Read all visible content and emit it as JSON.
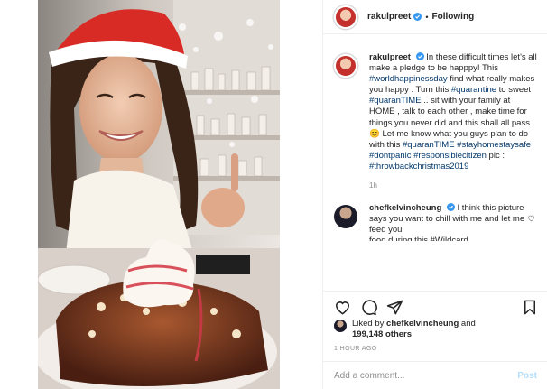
{
  "post": {
    "username": "rakulpreet",
    "follow_status": "Following",
    "separator": "•"
  },
  "caption": {
    "username": "rakulpreet",
    "segments": [
      {
        "text": "In these difficult times let's all make a pledge to be happpy! This ",
        "type": "text"
      },
      {
        "text": "#worldhappinessday",
        "type": "tag"
      },
      {
        "text": " find what really makes you happy . Turn this ",
        "type": "text"
      },
      {
        "text": "#quarantine",
        "type": "tag"
      },
      {
        "text": " to sweet ",
        "type": "text"
      },
      {
        "text": "#quaranTIME",
        "type": "tag"
      },
      {
        "text": " .. sit with your family at HOME , talk to each other , make time for things you never did and this shall all pass 😊 Let me know what you guys plan to do with this ",
        "type": "text"
      },
      {
        "text": "#quaranTIME",
        "type": "tag"
      },
      {
        "text": " ",
        "type": "text"
      },
      {
        "text": "#stayhomestaysafe",
        "type": "tag"
      },
      {
        "text": " ",
        "type": "text"
      },
      {
        "text": "#dontpanic",
        "type": "tag"
      },
      {
        "text": " ",
        "type": "text"
      },
      {
        "text": "#responsiblecitizen",
        "type": "tag"
      },
      {
        "text": " pic : ",
        "type": "text"
      },
      {
        "text": "#throwbackchristmas2019",
        "type": "tag"
      }
    ],
    "time": "1h"
  },
  "comment": {
    "username": "chefkelvincheung",
    "text": "I think this picture says you want to chill with me and let me feed you",
    "truncated_line": "food during this #Wildcard"
  },
  "likes": {
    "liked_by_label": "Liked by",
    "liked_by_user": "chefkelvincheung",
    "and_label": "and",
    "others_count": "199,148 others"
  },
  "timestamp": "1 HOUR AGO",
  "add_comment": {
    "placeholder": "Add a comment...",
    "post_label": "Post"
  },
  "icons": {
    "verified": "verified-badge-icon",
    "like": "heart-icon",
    "comment": "comment-icon",
    "share": "send-icon",
    "save": "bookmark-icon",
    "comment_like": "heart-icon"
  },
  "colors": {
    "text": "#262626",
    "tag": "#00376b",
    "muted": "#8e8e8e",
    "verified": "#3897f0",
    "post_button": "#b2dffc",
    "border": "#efefef"
  }
}
